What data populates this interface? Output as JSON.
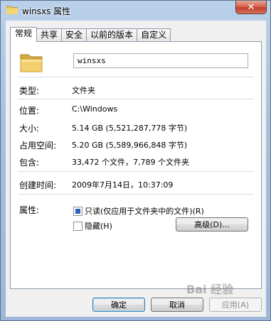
{
  "window": {
    "title": "winsxs 属性",
    "close_symbol": "✕"
  },
  "tabs": [
    {
      "label": "常规",
      "active": true
    },
    {
      "label": "共享"
    },
    {
      "label": "安全"
    },
    {
      "label": "以前的版本"
    },
    {
      "label": "自定义"
    }
  ],
  "general": {
    "name_value": "winsxs",
    "type_label": "类型:",
    "type_value": "文件夹",
    "location_label": "位置:",
    "location_value": "C:\\Windows",
    "size_label": "大小:",
    "size_value": "5.14 GB (5,521,287,778 字节)",
    "disk_label": "占用空间:",
    "disk_value": "5.20 GB (5,589,966,848 字节)",
    "contains_label": "包含:",
    "contains_value": "33,472 个文件，7,789 个文件夹",
    "created_label": "创建时间:",
    "created_value": "2009年7月14日，10:37:09",
    "attributes_label": "属性:",
    "readonly_label": "只读(仅应用于文件夹中的文件)(R)",
    "readonly_checked": true,
    "hidden_label": "隐藏(H)",
    "hidden_checked": false,
    "advanced_button": "高级(D)..."
  },
  "footer": {
    "ok": "确定",
    "cancel": "取消",
    "apply": "应用(A)"
  },
  "watermark": "Bai 经验",
  "colors": {
    "accent": "#2a65b8",
    "close": "#c1402a"
  }
}
